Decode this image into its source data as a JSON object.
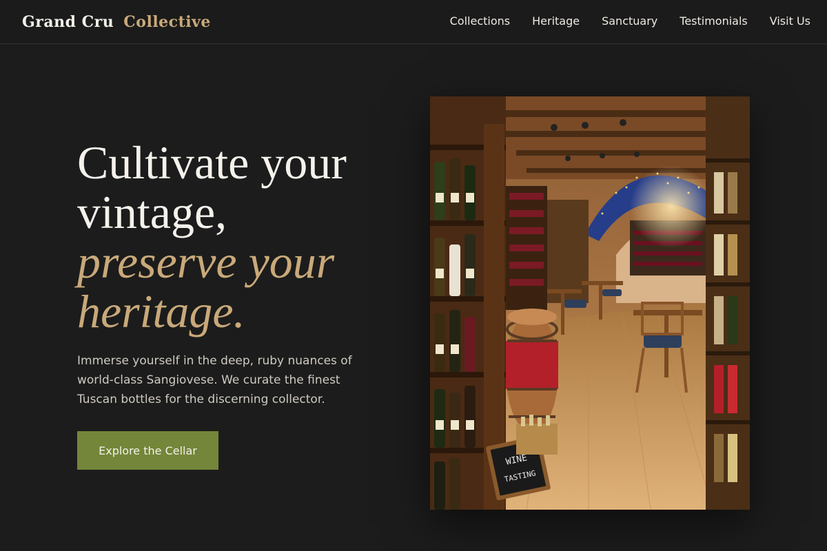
{
  "header": {
    "brand_primary": "Grand Cru",
    "brand_accent": "Collective",
    "nav": [
      {
        "label": "Collections"
      },
      {
        "label": "Heritage"
      },
      {
        "label": "Sanctuary"
      },
      {
        "label": "Testimonials"
      },
      {
        "label": "Visit Us"
      }
    ]
  },
  "hero": {
    "title_line1": "Cultivate your",
    "title_line2": "vintage,",
    "title_accent1": "preserve your",
    "title_accent2": "heritage.",
    "subtitle": "Immerse yourself in the deep, ruby nuances of world-class Sangiovese. We curate the finest Tuscan bottles for the discerning collector.",
    "cta_label": "Explore the Cellar"
  },
  "photo": {
    "sign_line1": "WINE",
    "sign_line2": "TASTING"
  },
  "colors": {
    "background": "#1c1c1c",
    "accent": "#c9a97a",
    "cta": "#738639"
  }
}
